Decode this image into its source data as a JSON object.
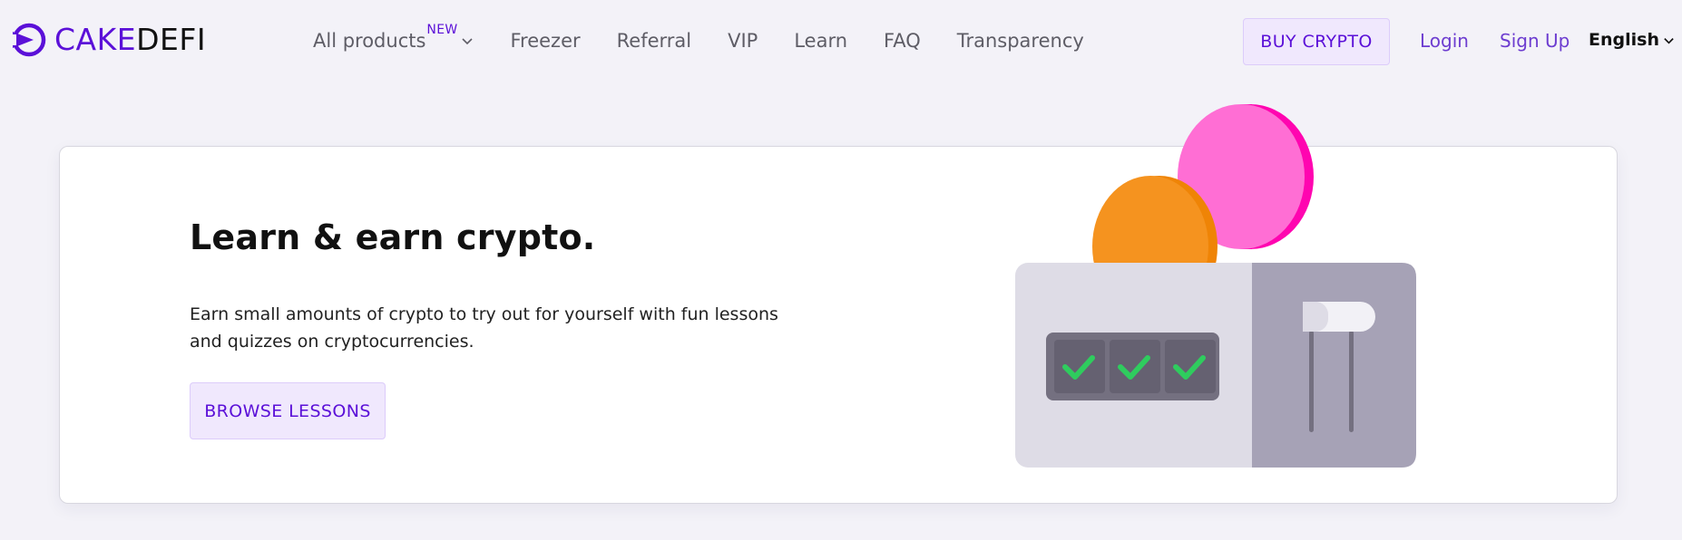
{
  "header": {
    "logo": {
      "part1": "CAKE",
      "part2": "DEFI",
      "brand_color": "#5b10d8"
    },
    "nav": {
      "all_products": "All products",
      "new_badge": "NEW",
      "freezer": "Freezer",
      "referral": "Referral",
      "vip": "VIP",
      "learn": "Learn",
      "faq": "FAQ",
      "transparency": "Transparency"
    },
    "buy_crypto": "BUY CRYPTO",
    "login": "Login",
    "sign_up": "Sign Up",
    "language": "English"
  },
  "hero": {
    "title": "Learn & earn crypto.",
    "description": "Earn small amounts of crypto to try out for yourself with fun lessons and quizzes on cryptocurrencies.",
    "browse_lessons": "BROWSE LESSONS",
    "illustration": {
      "icons": [
        "orange-coin-icon",
        "pink-coin-icon",
        "check-icon",
        "lever-icon"
      ],
      "colors": {
        "orange_coin": "#f5931f",
        "pink_coin": "#ff6ed4",
        "machine_body": "#dedce6",
        "machine_side": "#a6a2b6",
        "display": "#747080",
        "check": "#2fcc5e"
      }
    }
  }
}
